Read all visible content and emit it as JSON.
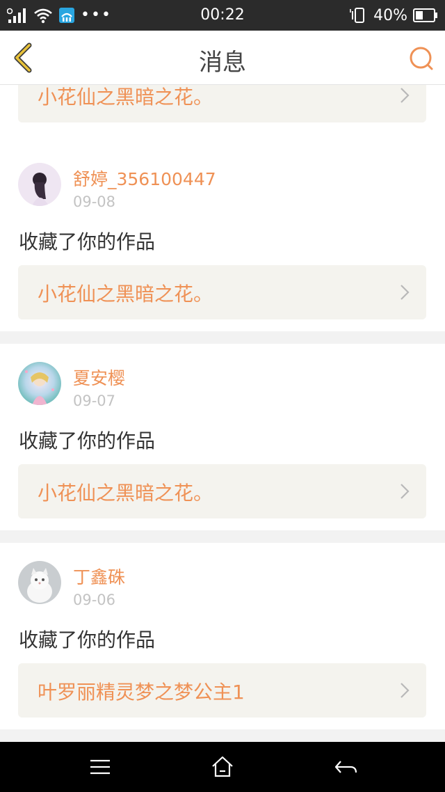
{
  "status_bar": {
    "time": "00:22",
    "battery": "40%",
    "icons": [
      "signal-icon",
      "wifi-icon",
      "data-icon",
      "more-dots-icon",
      "vibrate-icon",
      "battery-icon"
    ]
  },
  "header": {
    "title": "消息"
  },
  "top_card": {
    "work_title": "小花仙之黑暗之花。"
  },
  "notifications": [
    {
      "user": "舒婷_356100447",
      "date": "09-08",
      "action": "收藏了你的作品",
      "work_title": "小花仙之黑暗之花。"
    },
    {
      "user": "夏安樱",
      "date": "09-07",
      "action": "收藏了你的作品",
      "work_title": "小花仙之黑暗之花。"
    },
    {
      "user": "丁鑫硃",
      "date": "09-06",
      "action": "收藏了你的作品",
      "work_title": "叶罗丽精灵梦之梦公主1"
    }
  ],
  "colors": {
    "accent": "#ef9155",
    "back_arrow": "#e8c23a",
    "card_bg": "#f4f3ee"
  }
}
